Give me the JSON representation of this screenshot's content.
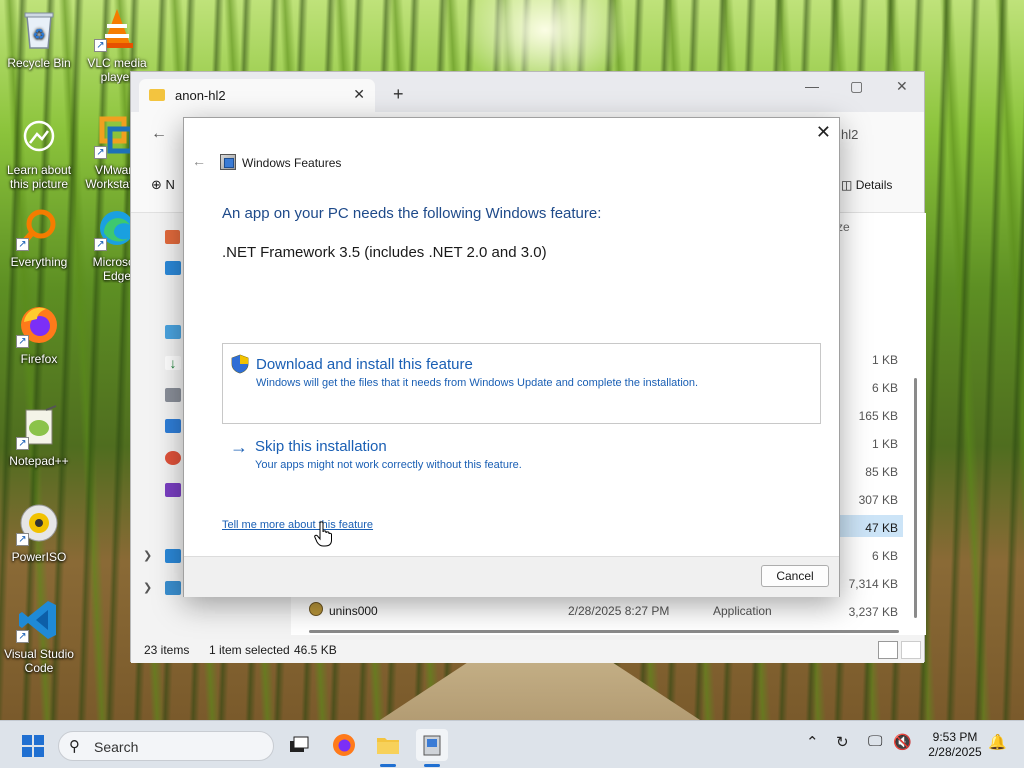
{
  "desktop": {
    "icons": [
      {
        "label": "Recycle Bin"
      },
      {
        "label": "VLC media player"
      },
      {
        "label": "Learn about this picture"
      },
      {
        "label": "VMware Workstation"
      },
      {
        "label": "Everything"
      },
      {
        "label": "Microsoft Edge"
      },
      {
        "label": "Firefox"
      },
      {
        "label": "Notepad++"
      },
      {
        "label": "PowerISO"
      },
      {
        "label": "Visual Studio Code"
      }
    ]
  },
  "explorer": {
    "tab_title": "anon-hl2",
    "crumb_tail": "hl2",
    "new_label": "N",
    "details_label": "Details",
    "size_header": "ze",
    "sizes": [
      "1 KB",
      "6 KB",
      "165 KB",
      "1 KB",
      "85 KB",
      "307 KB",
      "47 KB",
      "6 KB",
      "7,314 KB",
      "3,237 KB"
    ],
    "last_row": {
      "name": "unins000",
      "date": "2/28/2025 8:27 PM",
      "type": "Application"
    },
    "status": {
      "items": "23 items",
      "selected": "1 item selected",
      "size": "46.5 KB"
    }
  },
  "dialog": {
    "title": "Windows Features",
    "headline": "An app on your PC needs the following Windows feature:",
    "feature": ".NET Framework 3.5 (includes .NET 2.0 and 3.0)",
    "download": {
      "title": "Download and install this feature",
      "desc": "Windows will get the files that it needs from Windows Update and complete the installation."
    },
    "skip": {
      "title": "Skip this installation",
      "desc": "Your apps might not work correctly without this feature."
    },
    "more_link": "Tell me more about this feature",
    "cancel_label": "Cancel"
  },
  "taskbar": {
    "search_label": "Search",
    "time": "9:53 PM",
    "date": "2/28/2025"
  }
}
